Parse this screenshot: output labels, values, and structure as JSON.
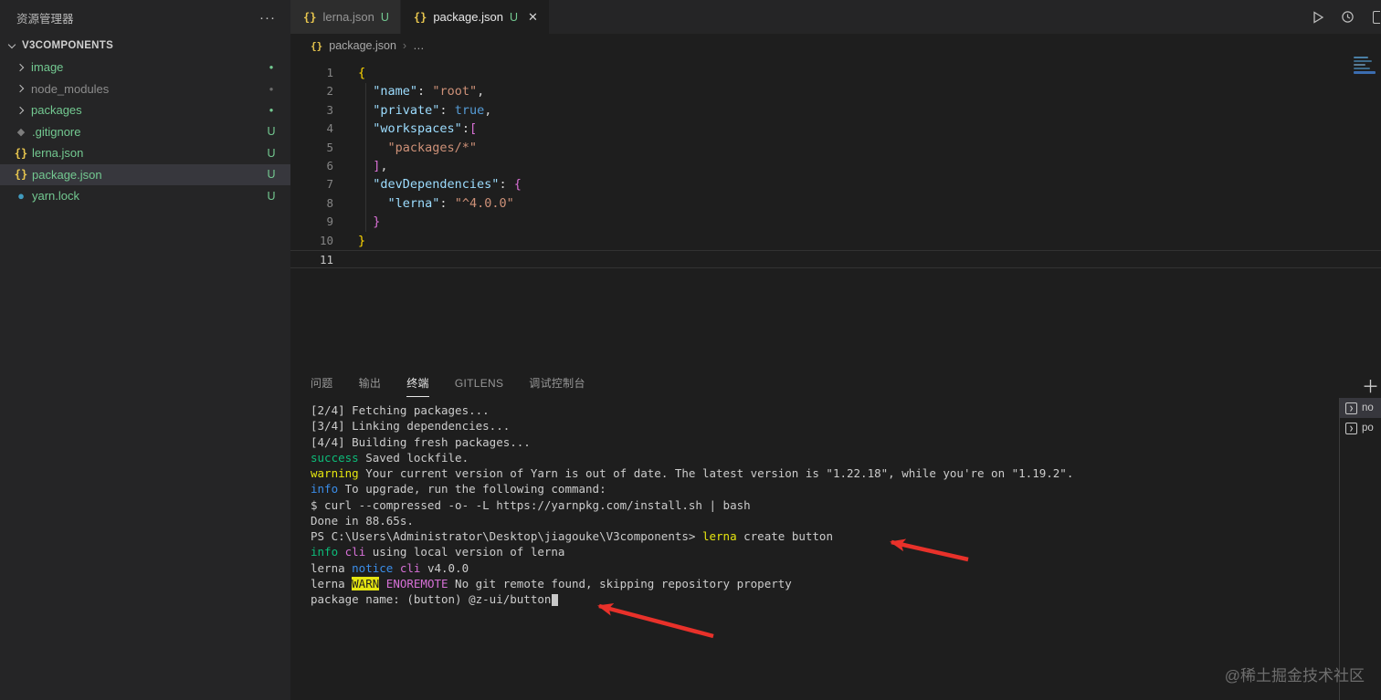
{
  "icons": {
    "more": "···",
    "close": "✕",
    "plus": "＋",
    "run_name": "run-icon",
    "history_name": "history-icon"
  },
  "sidebar": {
    "header": "资源管理器",
    "section": "V3COMPONENTS",
    "items": [
      {
        "label": "image",
        "type": "folder",
        "state": "added",
        "badge": "●"
      },
      {
        "label": "node_modules",
        "type": "folder",
        "state": "ignored",
        "badge": "●"
      },
      {
        "label": "packages",
        "type": "folder",
        "state": "added",
        "badge": "●"
      },
      {
        "label": ".gitignore",
        "type": "file",
        "icon": "git",
        "state": "added",
        "badge": "U"
      },
      {
        "label": "lerna.json",
        "type": "file",
        "icon": "json",
        "state": "added",
        "badge": "U"
      },
      {
        "label": "package.json",
        "type": "file",
        "icon": "json",
        "state": "added",
        "badge": "U",
        "selected": true
      },
      {
        "label": "yarn.lock",
        "type": "file",
        "icon": "yarn",
        "state": "added",
        "badge": "U"
      }
    ]
  },
  "tabs": [
    {
      "label": "lerna.json",
      "dirty": "U",
      "active": false
    },
    {
      "label": "package.json",
      "dirty": "U",
      "active": true
    }
  ],
  "breadcrumb": {
    "file": "package.json",
    "sep": "›",
    "more": "…"
  },
  "editor": {
    "lines": [
      {
        "num": 1,
        "segments": [
          {
            "t": "{",
            "c": "b1"
          }
        ]
      },
      {
        "num": 2,
        "segments": [
          {
            "t": "  ",
            "c": "pun"
          },
          {
            "t": "\"name\"",
            "c": "key"
          },
          {
            "t": ": ",
            "c": "pun"
          },
          {
            "t": "\"root\"",
            "c": "str"
          },
          {
            "t": ",",
            "c": "pun"
          }
        ]
      },
      {
        "num": 3,
        "segments": [
          {
            "t": "  ",
            "c": "pun"
          },
          {
            "t": "\"private\"",
            "c": "key"
          },
          {
            "t": ": ",
            "c": "pun"
          },
          {
            "t": "true",
            "c": "kw"
          },
          {
            "t": ",",
            "c": "pun"
          }
        ]
      },
      {
        "num": 4,
        "segments": [
          {
            "t": "  ",
            "c": "pun"
          },
          {
            "t": "\"workspaces\"",
            "c": "key"
          },
          {
            "t": ":",
            "c": "pun"
          },
          {
            "t": "[",
            "c": "b2"
          }
        ]
      },
      {
        "num": 5,
        "segments": [
          {
            "t": "    ",
            "c": "pun"
          },
          {
            "t": "\"packages/*\"",
            "c": "str"
          }
        ]
      },
      {
        "num": 6,
        "segments": [
          {
            "t": "  ",
            "c": "pun"
          },
          {
            "t": "]",
            "c": "b2"
          },
          {
            "t": ",",
            "c": "pun"
          }
        ]
      },
      {
        "num": 7,
        "segments": [
          {
            "t": "  ",
            "c": "pun"
          },
          {
            "t": "\"devDependencies\"",
            "c": "key"
          },
          {
            "t": ": ",
            "c": "pun"
          },
          {
            "t": "{",
            "c": "b2"
          }
        ]
      },
      {
        "num": 8,
        "segments": [
          {
            "t": "    ",
            "c": "pun"
          },
          {
            "t": "\"lerna\"",
            "c": "key"
          },
          {
            "t": ": ",
            "c": "pun"
          },
          {
            "t": "\"^4.0.0\"",
            "c": "str"
          }
        ]
      },
      {
        "num": 9,
        "segments": [
          {
            "t": "  ",
            "c": "pun"
          },
          {
            "t": "}",
            "c": "b2"
          }
        ]
      },
      {
        "num": 10,
        "segments": [
          {
            "t": "}",
            "c": "b1"
          }
        ]
      },
      {
        "num": 11,
        "segments": [],
        "current": true
      }
    ]
  },
  "panel": {
    "tabs": [
      "问题",
      "输出",
      "终端",
      "GITLENS",
      "调试控制台"
    ],
    "active": "终端"
  },
  "terminal": {
    "lines": [
      {
        "segments": [
          {
            "t": "[2/4] Fetching packages...",
            "c": "p"
          }
        ]
      },
      {
        "segments": [
          {
            "t": "[3/4] Linking dependencies...",
            "c": "p"
          }
        ]
      },
      {
        "segments": [
          {
            "t": "[4/4] Building fresh packages...",
            "c": "p"
          }
        ]
      },
      {
        "segments": [
          {
            "t": "success",
            "c": "g"
          },
          {
            "t": " Saved lockfile.",
            "c": "p"
          }
        ]
      },
      {
        "segments": [
          {
            "t": "warning",
            "c": "y"
          },
          {
            "t": " Your current version of Yarn is out of date. The latest version is \"1.22.18\", while you're on \"1.19.2\".",
            "c": "p"
          }
        ]
      },
      {
        "segments": [
          {
            "t": "info",
            "c": "b"
          },
          {
            "t": " To upgrade, run the following command:",
            "c": "p"
          }
        ]
      },
      {
        "segments": [
          {
            "t": "$ curl --compressed -o- -L https://yarnpkg.com/install.sh | bash",
            "c": "p"
          }
        ]
      },
      {
        "segments": [
          {
            "t": "Done in 88.65s.",
            "c": "p"
          }
        ]
      },
      {
        "segments": [
          {
            "t": "PS C:\\Users\\Administrator\\Desktop\\jiagouke\\V3components> ",
            "c": "p"
          },
          {
            "t": "lerna",
            "c": "y"
          },
          {
            "t": " create button",
            "c": "p"
          }
        ]
      },
      {
        "segments": [
          {
            "t": "info",
            "c": "g"
          },
          {
            "t": " ",
            "c": "p"
          },
          {
            "t": "cli",
            "c": "m"
          },
          {
            "t": " using local version of lerna",
            "c": "p"
          }
        ]
      },
      {
        "segments": [
          {
            "t": "lerna ",
            "c": "p"
          },
          {
            "t": "notice",
            "c": "b"
          },
          {
            "t": " ",
            "c": "p"
          },
          {
            "t": "cli",
            "c": "m"
          },
          {
            "t": " v4.0.0",
            "c": "p"
          }
        ]
      },
      {
        "segments": [
          {
            "t": "lerna ",
            "c": "p"
          },
          {
            "t": "WARN",
            "c": "wb"
          },
          {
            "t": " ",
            "c": "p"
          },
          {
            "t": "ENOREMOTE",
            "c": "m"
          },
          {
            "t": " No git remote found, skipping repository property",
            "c": "p"
          }
        ]
      },
      {
        "segments": [
          {
            "t": "package name: (button) @z-ui/button",
            "c": "p"
          }
        ],
        "cursor": true
      }
    ]
  },
  "terminal_list": {
    "items": [
      "no",
      "po"
    ]
  },
  "watermark": "@稀土掘金技术社区"
}
